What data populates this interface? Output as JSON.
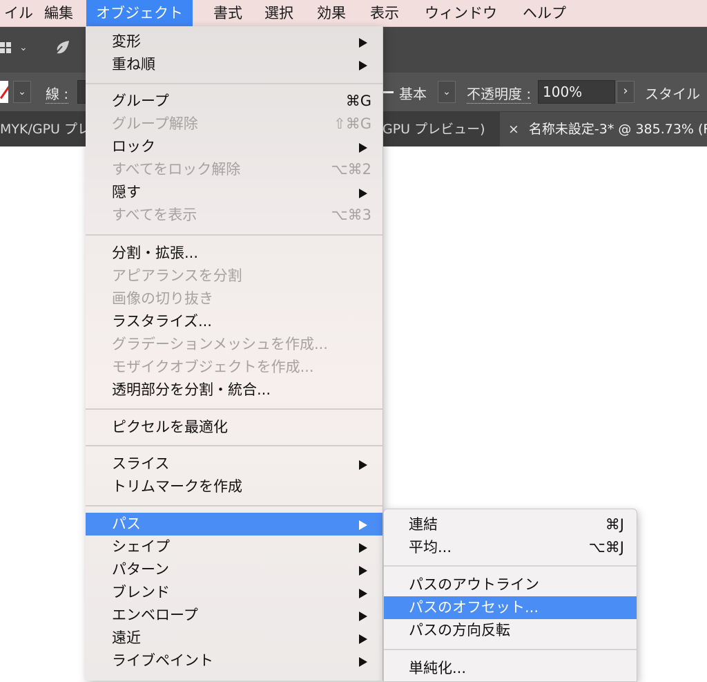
{
  "menubar": {
    "items": [
      "イル",
      "編集",
      "オブジェクト",
      "書式",
      "選択",
      "効果",
      "表示",
      "ウィンドウ",
      "ヘルプ"
    ],
    "active_index": 2
  },
  "control_bar": {
    "stroke_label": "線 :",
    "brush_preset": "基本",
    "opacity_label": "不透明度 :",
    "opacity_value": "100%",
    "style_label": "スタイル"
  },
  "tabs": [
    {
      "label": "MYK/GPU プレ",
      "current": false
    },
    {
      "label": "GPU プレビュー)",
      "current": false
    },
    {
      "label": "名称未設定-3* @ 385.73% (R",
      "current": true,
      "close": "×"
    }
  ],
  "object_menu": {
    "groups": [
      [
        {
          "label": "変形",
          "submenu": true
        },
        {
          "label": "重ね順",
          "submenu": true
        }
      ],
      [
        {
          "label": "グループ",
          "shortcut": "⌘G"
        },
        {
          "label": "グループ解除",
          "shortcut": "⇧⌘G",
          "disabled": true
        },
        {
          "label": "ロック",
          "submenu": true
        },
        {
          "label": "すべてをロック解除",
          "shortcut": "⌥⌘2",
          "disabled": true
        },
        {
          "label": "隠す",
          "submenu": true
        },
        {
          "label": "すべてを表示",
          "shortcut": "⌥⌘3",
          "disabled": true
        }
      ],
      [
        {
          "label": "分割・拡張..."
        },
        {
          "label": "アピアランスを分割",
          "disabled": true
        },
        {
          "label": "画像の切り抜き",
          "disabled": true
        },
        {
          "label": "ラスタライズ..."
        },
        {
          "label": "グラデーションメッシュを作成...",
          "disabled": true
        },
        {
          "label": "モザイクオブジェクトを作成...",
          "disabled": true
        },
        {
          "label": "透明部分を分割・統合..."
        }
      ],
      [
        {
          "label": "ピクセルを最適化"
        }
      ],
      [
        {
          "label": "スライス",
          "submenu": true
        },
        {
          "label": "トリムマークを作成"
        }
      ],
      [
        {
          "label": "パス",
          "submenu": true,
          "active": true
        },
        {
          "label": "シェイプ",
          "submenu": true
        },
        {
          "label": "パターン",
          "submenu": true
        },
        {
          "label": "ブレンド",
          "submenu": true
        },
        {
          "label": "エンベロープ",
          "submenu": true
        },
        {
          "label": "遠近",
          "submenu": true
        },
        {
          "label": "ライブペイント",
          "submenu": true
        }
      ]
    ]
  },
  "path_submenu": {
    "groups": [
      [
        {
          "label": "連結",
          "shortcut": "⌘J"
        },
        {
          "label": "平均...",
          "shortcut": "⌥⌘J"
        }
      ],
      [
        {
          "label": "パスのアウトライン"
        },
        {
          "label": "パスのオフセット...",
          "active": true
        },
        {
          "label": "パスの方向反転"
        }
      ],
      [
        {
          "label": "単純化..."
        }
      ]
    ]
  }
}
